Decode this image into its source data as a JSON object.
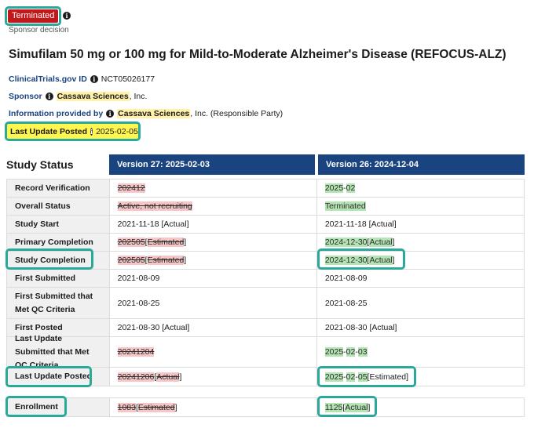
{
  "status_badge": "Terminated",
  "sponsor_decision": "Sponsor decision",
  "study_title": "Simufilam 50 mg or 100 mg for Mild-to-Moderate Alzheimer's Disease (REFOCUS-ALZ)",
  "meta": {
    "ct_label": "ClinicalTrials.gov ID",
    "ct_value": "NCT05026177",
    "sponsor_label": "Sponsor",
    "sponsor_name": "Cassava Sciences",
    "sponsor_suffix": ", Inc.",
    "info_label": "Information provided by",
    "info_name": "Cassava Sciences",
    "info_suffix": ", Inc. (Responsible Party)",
    "lup_label": "Last Update Posted",
    "lup_value": "2025-02-05"
  },
  "study_status": {
    "heading": "Study Status",
    "v27_header": "Version 27: 2025-02-03",
    "v26_header": "Version 26: 2024-12-04",
    "rows": [
      {
        "label": "Record Verification",
        "v27": [
          {
            "t": "2024",
            "c": "del"
          },
          {
            "t": " "
          },
          {
            "t": "12",
            "c": "del"
          }
        ],
        "v26": [
          {
            "t": "2025",
            "c": "ins"
          },
          {
            "t": "-"
          },
          {
            "t": "02",
            "c": "ins"
          }
        ]
      },
      {
        "label": "Overall Status",
        "v27": [
          {
            "t": "Active, not recruiting",
            "c": "del"
          }
        ],
        "v26": [
          {
            "t": "Terminated",
            "c": "ins"
          }
        ]
      },
      {
        "label": "Study Start",
        "v27": [
          {
            "t": "2021-11-18 [Actual]"
          }
        ],
        "v26": [
          {
            "t": "2021-11-18 [Actual]"
          }
        ]
      },
      {
        "label": "Primary Completion",
        "v27": [
          {
            "t": "2025",
            "c": "del"
          },
          {
            "t": " "
          },
          {
            "t": "05",
            "c": "del"
          },
          {
            "t": " ["
          },
          {
            "t": "Estimated",
            "c": "del"
          },
          {
            "t": "]"
          }
        ],
        "v26": [
          {
            "t": "2024-12-30",
            "c": "ins"
          },
          {
            "t": " ["
          },
          {
            "t": "Actual",
            "c": "ins"
          },
          {
            "t": "]"
          }
        ]
      },
      {
        "label": "Study Completion",
        "v27": [
          {
            "t": "2025",
            "c": "del"
          },
          {
            "t": " "
          },
          {
            "t": "05",
            "c": "del"
          },
          {
            "t": " ["
          },
          {
            "t": "Estimated",
            "c": "del"
          },
          {
            "t": "]"
          }
        ],
        "v26": [
          {
            "t": "2024-12-30",
            "c": "ins"
          },
          {
            "t": " ["
          },
          {
            "t": "Actual",
            "c": "ins"
          },
          {
            "t": "]"
          }
        ]
      },
      {
        "label": "First Submitted",
        "v27": [
          {
            "t": "2021-08-09"
          }
        ],
        "v26": [
          {
            "t": "2021-08-09"
          }
        ]
      },
      {
        "label": "First Submitted that Met QC Criteria",
        "v27": [
          {
            "t": "2021-08-25"
          }
        ],
        "v26": [
          {
            "t": "2021-08-25"
          }
        ]
      },
      {
        "label": "First Posted",
        "v27": [
          {
            "t": "2021-08-30 [Actual]"
          }
        ],
        "v26": [
          {
            "t": "2021-08-30 [Actual]"
          }
        ]
      },
      {
        "label": "Last Update Submitted that Met QC Criteria",
        "v27": [
          {
            "t": "2024",
            "c": "del"
          },
          {
            "t": " "
          },
          {
            "t": "12",
            "c": "del"
          },
          {
            "t": " "
          },
          {
            "t": "04",
            "c": "del"
          }
        ],
        "v26": [
          {
            "t": "2025",
            "c": "ins"
          },
          {
            "t": "-"
          },
          {
            "t": "02",
            "c": "ins"
          },
          {
            "t": "-"
          },
          {
            "t": "03",
            "c": "ins"
          }
        ]
      },
      {
        "label": "Last Update Posted",
        "v27": [
          {
            "t": "2024",
            "c": "del"
          },
          {
            "t": " "
          },
          {
            "t": "12",
            "c": "del"
          },
          {
            "t": " "
          },
          {
            "t": "06",
            "c": "del"
          },
          {
            "t": " ["
          },
          {
            "t": "Actual",
            "c": "del"
          },
          {
            "t": "]"
          }
        ],
        "v26": [
          {
            "t": "2025",
            "c": "ins"
          },
          {
            "t": "-"
          },
          {
            "t": "02",
            "c": "ins"
          },
          {
            "t": "-"
          },
          {
            "t": "05",
            "c": "ins"
          },
          {
            "t": " [Estimated]"
          }
        ]
      }
    ],
    "enrollment": {
      "label": "Enrollment",
      "v27": [
        {
          "t": "1083",
          "c": "del"
        },
        {
          "t": " ["
        },
        {
          "t": "Estimated",
          "c": "del"
        },
        {
          "t": "]"
        }
      ],
      "v26": [
        {
          "t": "1125",
          "c": "ins"
        },
        {
          "t": " ["
        },
        {
          "t": "Actual",
          "c": "ins"
        },
        {
          "t": "]"
        }
      ]
    }
  },
  "colors": {
    "badge_red": "#c3171b",
    "header_blue": "#1a4480",
    "highlight_teal": "#2aa89a",
    "ins_green": "#b5e4b4",
    "del_red": "#f7c6c7",
    "lup_yellow": "#fff64f"
  }
}
